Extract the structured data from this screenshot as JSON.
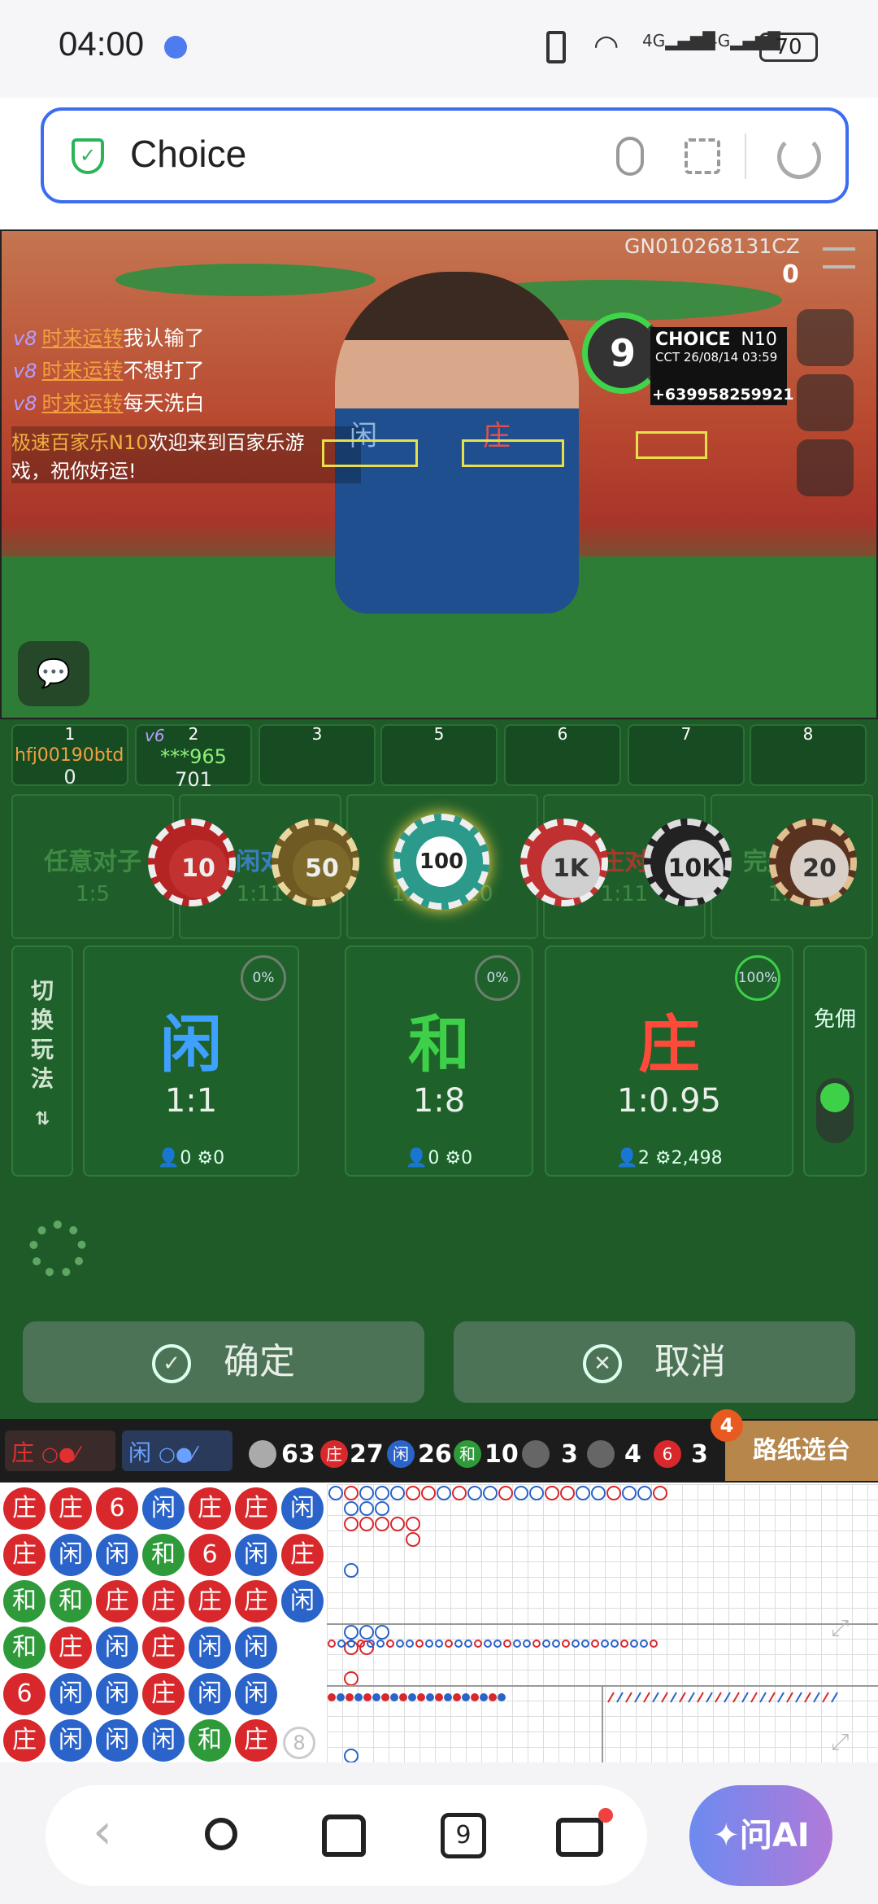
{
  "status": {
    "time": "04:00",
    "battery": "70"
  },
  "address": {
    "text": "Choice"
  },
  "video": {
    "game_id": "GN010268131CZ",
    "counter": "0",
    "timer": "9",
    "brand": "CHOICE",
    "table": "N10",
    "datetime": "CCT 26/08/14 03:59",
    "phone": "+639958259921",
    "player_lbl": "PLAYER",
    "player_cn": "闲",
    "banker_lbl": "BANKER",
    "banker_cn": "庄",
    "chat": [
      {
        "user": "时来运转",
        "msg": "我认输了"
      },
      {
        "user": "时来运转",
        "msg": "不想打了"
      },
      {
        "user": "时来运转",
        "msg": "每天洗白"
      }
    ],
    "welcome_1": "极速百家乐N10",
    "welcome_2": "欢迎来到百家乐游",
    "welcome_3": "戏，祝你好运!"
  },
  "seats": [
    {
      "n": "1",
      "name": "hfj00190btd",
      "val": "0"
    },
    {
      "n": "2",
      "name": "***965",
      "val": "701",
      "vip": "v6"
    },
    {
      "n": "3"
    },
    {
      "n": "5"
    },
    {
      "n": "6"
    },
    {
      "n": "7"
    },
    {
      "n": "8"
    }
  ],
  "side_bets": [
    {
      "name": "任意对子",
      "odds": "1:5"
    },
    {
      "name": "闲对",
      "odds": "1:11"
    },
    {
      "name": "幸运六",
      "odds": "1:12   1:20"
    },
    {
      "name": "庄对",
      "odds": "1:11"
    },
    {
      "name": "完美对子",
      "odds": "1:25"
    }
  ],
  "switch_label": "切换玩法",
  "main_bets": [
    {
      "name": "闲",
      "odds": "1:1",
      "pct": "0%",
      "players": "0",
      "amount": "0",
      "color": "#3ea0ff"
    },
    {
      "name": "和",
      "odds": "1:8",
      "pct": "0%",
      "players": "0",
      "amount": "0",
      "color": "#3fd04a"
    },
    {
      "name": "庄",
      "odds": "1:0.95",
      "pct": "100%",
      "players": "2",
      "amount": "2,498",
      "color": "#ff4a3a"
    }
  ],
  "commission": {
    "label": "免佣",
    "on": true
  },
  "chips": [
    "10",
    "50",
    "100",
    "1K",
    "10K",
    "20"
  ],
  "confirm": "确定",
  "cancel": "取消",
  "road": {
    "banker_tag": "庄",
    "player_tag": "闲",
    "total": "63",
    "banker": "27",
    "player": "26",
    "tie": "10",
    "bpair": "3",
    "ppair": "4",
    "six": "3",
    "badge": "4",
    "select": "路纸选台"
  },
  "bead_rows": [
    [
      "庄",
      "庄",
      "6",
      "闲",
      "庄",
      "庄",
      "闲"
    ],
    [
      "庄",
      "闲",
      "闲",
      "和",
      "6",
      "闲",
      "庄"
    ],
    [
      "和",
      "和",
      "庄",
      "庄",
      "庄",
      "庄",
      "闲"
    ],
    [
      "和",
      "庄",
      "闲",
      "庄",
      "闲",
      "闲",
      ""
    ],
    [
      "6",
      "闲",
      "闲",
      "庄",
      "闲",
      "闲",
      ""
    ],
    [
      "庄",
      "闲",
      "闲",
      "闲",
      "和",
      "庄",
      ""
    ]
  ],
  "bead_badge": "8",
  "nav": {
    "tabs": "9",
    "ai": "问AI"
  },
  "colors": {
    "banker": "#d8282c",
    "player": "#2a63c9",
    "tie": "#2e9a3a",
    "six": "#d8282c"
  }
}
